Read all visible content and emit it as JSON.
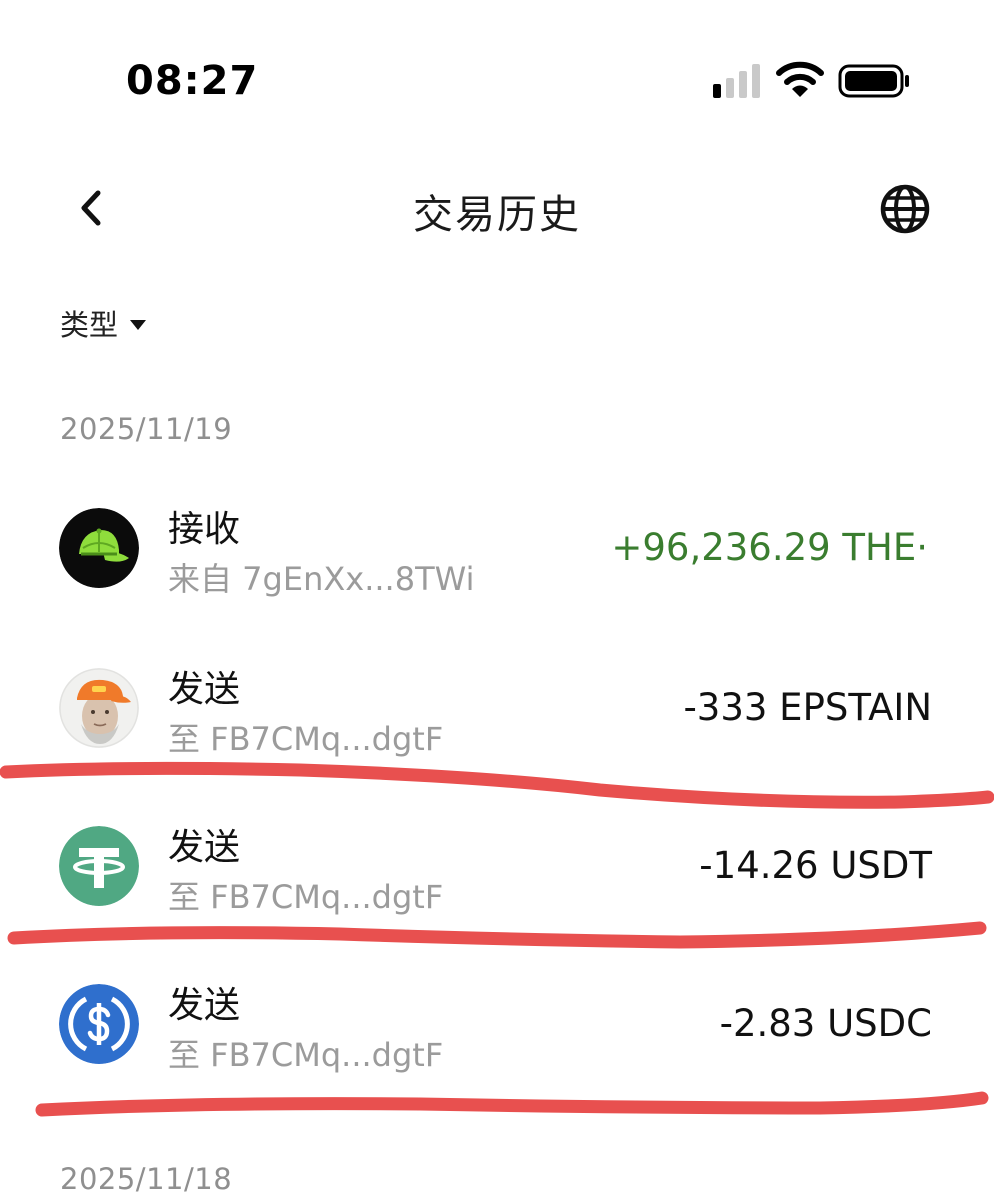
{
  "status_bar": {
    "time": "08:27"
  },
  "nav": {
    "title": "交易历史",
    "back_icon": "chevron-left-icon",
    "language_icon": "globe-icon"
  },
  "filter": {
    "label": "类型"
  },
  "groups": [
    {
      "date": "2025/11/19",
      "transactions": [
        {
          "type": "接收",
          "address": "来自 7gEnXx...8TWi",
          "amount": "+96,236.29 THE·",
          "token_icon": "green-cap-icon",
          "direction": "in"
        },
        {
          "type": "发送",
          "address": "至 FB7CMq...dgtF",
          "amount": "-333 EPSTAIN",
          "token_icon": "epstain-avatar-icon",
          "direction": "out"
        },
        {
          "type": "发送",
          "address": "至 FB7CMq...dgtF",
          "amount": "-14.26 USDT",
          "token_icon": "usdt-icon",
          "direction": "out"
        },
        {
          "type": "发送",
          "address": "至 FB7CMq...dgtF",
          "amount": "-2.83 USDC",
          "token_icon": "usdc-icon",
          "direction": "out"
        }
      ]
    },
    {
      "date": "2025/11/18",
      "transactions": []
    }
  ],
  "colors": {
    "positive_amount": "#3a7d2f",
    "secondary_text": "#9b9b9b",
    "marker_red": "#e8504f",
    "usdt_green": "#50a883",
    "usdc_blue": "#2f6fcd"
  }
}
